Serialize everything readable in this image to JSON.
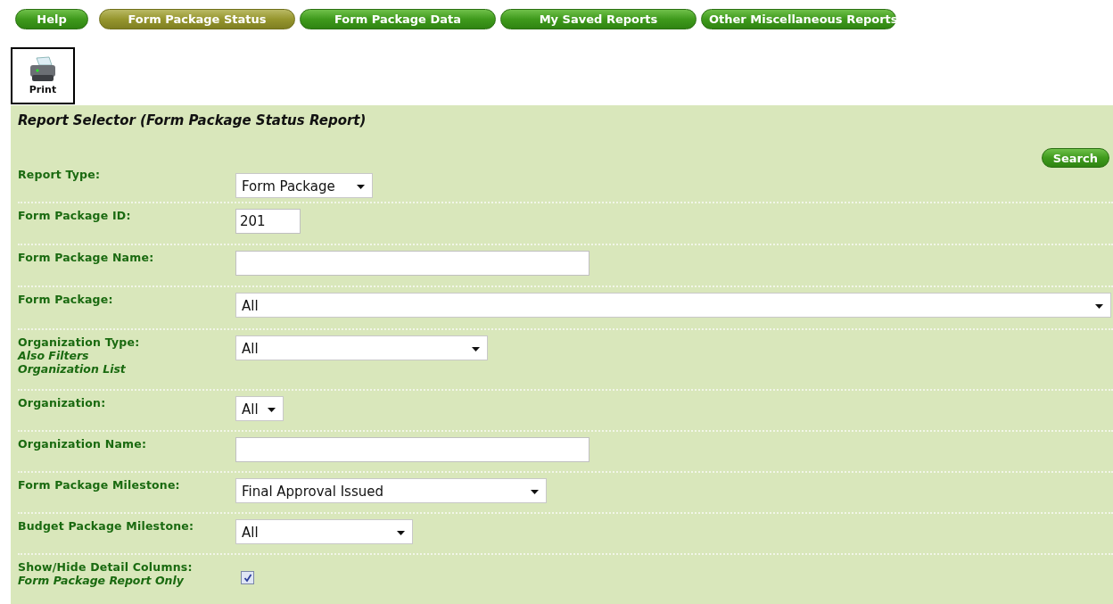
{
  "tabs": [
    {
      "label": "Help",
      "selected": false
    },
    {
      "label": "Form Package Status",
      "selected": true
    },
    {
      "label": "Form Package Data",
      "selected": false
    },
    {
      "label": "My Saved Reports",
      "selected": false
    },
    {
      "label": "Other Miscellaneous Reports",
      "selected": false
    }
  ],
  "print_button": {
    "label": "Print"
  },
  "panel": {
    "title": "Report Selector (Form Package Status Report)",
    "search_button": "Search",
    "rows": [
      {
        "label": "Report Type:",
        "kind": "select",
        "value": "Form Package"
      },
      {
        "label": "Form Package ID:",
        "kind": "text",
        "value": "201"
      },
      {
        "label": "Form Package Name:",
        "kind": "text"
      },
      {
        "label": "Form Package:",
        "kind": "select",
        "value": "All"
      },
      {
        "label": "Organization Type:",
        "notes": [
          "Also Filters",
          "Organization List"
        ],
        "kind": "select",
        "value": "All"
      },
      {
        "label": "Organization:",
        "kind": "select",
        "value": "All"
      },
      {
        "label": "Organization Name:",
        "kind": "text"
      },
      {
        "label": "Form Package Milestone:",
        "kind": "select",
        "value": "Final Approval Issued"
      },
      {
        "label": "Budget Package Milestone:",
        "kind": "select",
        "value": "All"
      },
      {
        "label": "Show/Hide Detail Columns:",
        "notes": [
          "Form Package Report Only"
        ],
        "kind": "checkbox",
        "checked": true
      }
    ]
  }
}
